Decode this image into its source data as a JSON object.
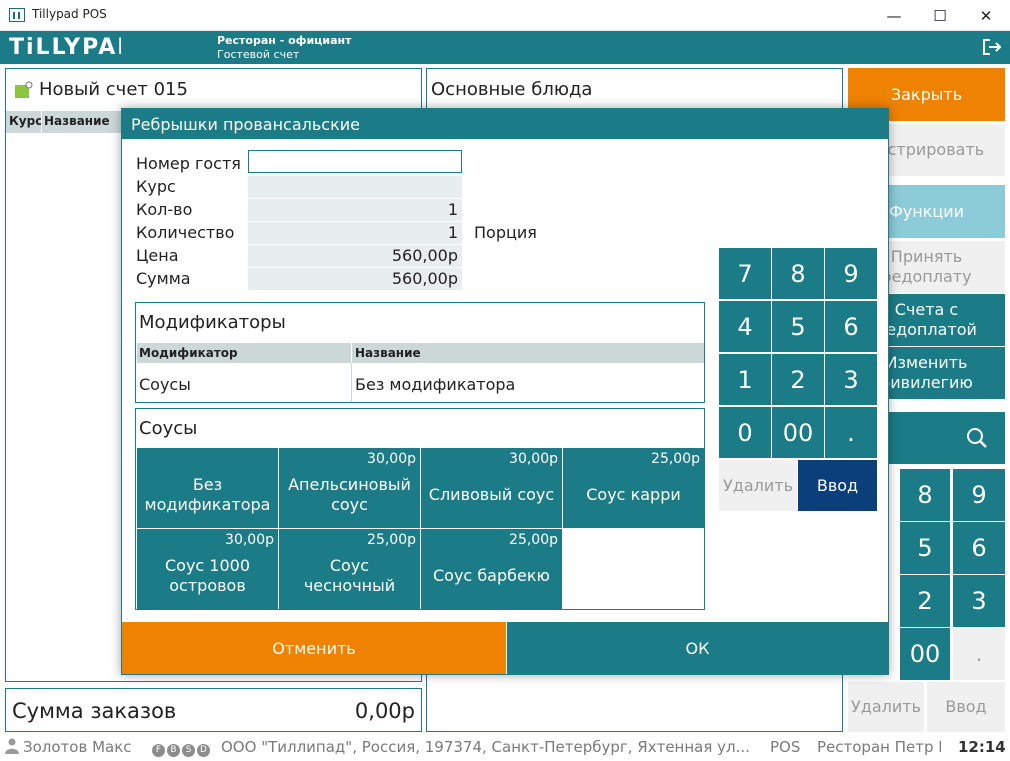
{
  "window": {
    "title": "Tillypad POS",
    "minimize": "—",
    "maximize": "☐",
    "close": "✕"
  },
  "header": {
    "logo": "TiLLYPAD",
    "line1": "Ресторан - официант",
    "line2": "Гостевой счет"
  },
  "left_panel": {
    "title": "Новый счет 015",
    "columns": [
      "Курс",
      "Название"
    ]
  },
  "center_panel": {
    "title": "Основные блюда"
  },
  "summary": {
    "label": "Сумма заказов",
    "value": "0,00р"
  },
  "right_column": {
    "close": "Закрыть",
    "register": "гистрировать",
    "functions": "Функции",
    "accept_prepay": "Принять\nредоплату",
    "prepay_accounts": "Счета с\nредоплатой",
    "change_privilege": "Изменить\nривилегию",
    "keys": [
      "8",
      "9",
      "5",
      "6",
      "2",
      "3",
      "00",
      "."
    ],
    "delete": "Удалить",
    "enter": "Ввод"
  },
  "statusbar": {
    "user": "Золотов Макс",
    "badges": [
      "F",
      "B",
      "S",
      "D"
    ],
    "org": "ООО \"Тиллипад\", Россия, 197374, Санкт-Петербург, Яхтенная ул...",
    "pos": "POS",
    "restaurant": "Ресторан Петр I",
    "time": "12:14"
  },
  "dialog": {
    "title": "Ребрышки провансальские",
    "fields": {
      "guest_label": "Номер гостя",
      "guest_value": "",
      "course_label": "Курс",
      "course_value": "",
      "qty_label": "Кол-во",
      "qty_value": "1",
      "quantity_label": "Количество",
      "quantity_value": "1",
      "unit": "Порция",
      "price_label": "Цена",
      "price_value": "560,00р",
      "sum_label": "Сумма",
      "sum_value": "560,00р"
    },
    "modifiers": {
      "title": "Модификаторы",
      "col_modifier": "Модификатор",
      "col_name": "Название",
      "row_modifier": "Соусы",
      "row_name": "Без модификатора"
    },
    "sauces": {
      "title": "Соусы",
      "items": [
        {
          "name": "Без модификатора",
          "price": ""
        },
        {
          "name": "Апельсиновый соус",
          "price": "30,00р"
        },
        {
          "name": "Сливовый соус",
          "price": "30,00р"
        },
        {
          "name": "Соус карри",
          "price": "25,00р"
        },
        {
          "name": "Соус 1000 островов",
          "price": "30,00р"
        },
        {
          "name": "Соус чесночный",
          "price": "25,00р"
        },
        {
          "name": "Соус барбекю",
          "price": "25,00р"
        }
      ]
    },
    "keypad": [
      "7",
      "8",
      "9",
      "4",
      "5",
      "6",
      "1",
      "2",
      "3",
      "0",
      "00",
      "."
    ],
    "keypad_delete": "Удалить",
    "keypad_enter": "Ввод",
    "cancel": "Отменить",
    "ok": "ОК"
  },
  "colors": {
    "teal": "#1b7b86",
    "orange": "#ef8200",
    "light_teal": "#8ccbd8",
    "navy": "#0b3f7c"
  }
}
